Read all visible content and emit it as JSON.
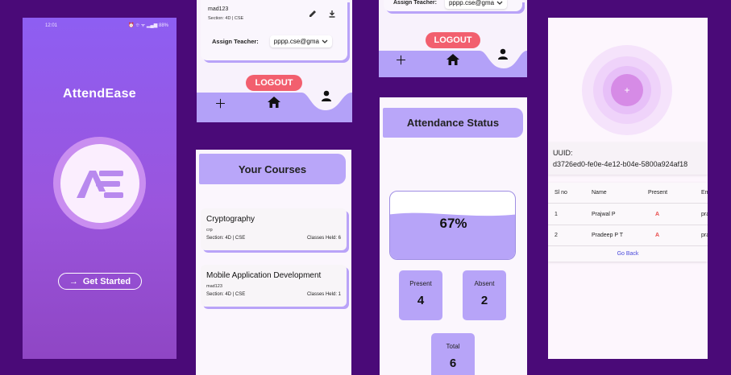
{
  "splash": {
    "status_time": "12:01",
    "status_icons": "⏰ ⯐ ᯤ ▂▄▆ 88%",
    "app_title": "AttendEase",
    "get_started_label": "Get Started",
    "arrow_glyph": "→"
  },
  "assign_screen": {
    "course_code": "mad123",
    "section": "Section: 4D | CSE",
    "assign_teacher_label": "Assign Teacher:",
    "teacher_email": "pppp.cse@gma",
    "logout_label": "LOGOUT"
  },
  "assign_screen_2": {
    "assign_teacher_label": "Assign Teacher:",
    "teacher_email": "pppp.cse@gma",
    "logout_label": "LOGOUT"
  },
  "courses_screen": {
    "title": "Your Courses",
    "courses": [
      {
        "name": "Cryptography",
        "code": "crp",
        "section": "Section: 4D | CSE",
        "classes": "Classes Held: 6"
      },
      {
        "name": "Mobile Application Development",
        "code": "mad123",
        "section": "Section: 4D | CSE",
        "classes": "Classes Held: 1"
      }
    ]
  },
  "attendance_screen": {
    "title": "Attendance Status",
    "percent_label": "67%",
    "percent": 67,
    "present_label": "Present",
    "present_value": "4",
    "absent_label": "Absent",
    "absent_value": "2",
    "total_label": "Total",
    "total_value": "6"
  },
  "uuid_screen": {
    "plus_glyph": "+",
    "uuid_label": "UUID:",
    "uuid_value": "d3726ed0-fe0e-4e12-b04e-5800a924af18",
    "columns": [
      "Sl no",
      "Name",
      "Present",
      "Em"
    ],
    "rows": [
      {
        "sl": "1",
        "name": "Prajwal P",
        "present": "A",
        "email": "pra"
      },
      {
        "sl": "2",
        "name": "Pradeep P T",
        "present": "A",
        "email": "pra"
      }
    ],
    "go_back_label": "Go Back"
  },
  "colors": {
    "accent": "#b7a4f8",
    "logout": "#f25f6e",
    "absent_mark": "#e94b4b",
    "link": "#4a4adb"
  }
}
